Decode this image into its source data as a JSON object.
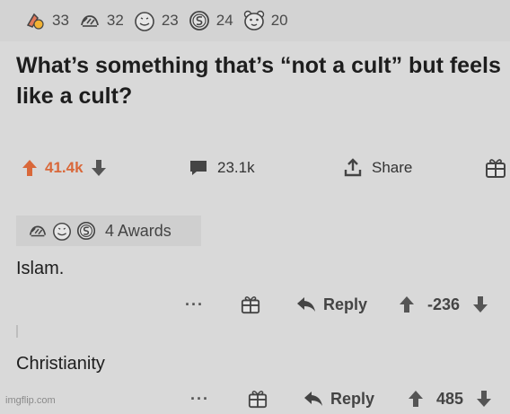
{
  "post": {
    "awards": [
      {
        "icon": "rocket-like-award-icon",
        "count": "33"
      },
      {
        "icon": "hands-award-icon",
        "count": "32"
      },
      {
        "icon": "face-award-icon",
        "count": "23"
      },
      {
        "icon": "coin-award-icon",
        "count": "24"
      },
      {
        "icon": "bear-award-icon",
        "count": "20"
      }
    ],
    "title": "What’s something that’s “not a cult” but feels like a cult?",
    "upvotes": "41.4k",
    "comments": "23.1k",
    "share_label": "Share"
  },
  "comments": [
    {
      "awards_label": "4 Awards",
      "body": "Islam.",
      "reply_label": "Reply",
      "score": "-236",
      "more": "···"
    },
    {
      "body": "Christianity",
      "reply_label": "Reply",
      "score": "485",
      "more": "···"
    }
  ],
  "watermark": "imgflip.com",
  "colors": {
    "background": "#d9d9d9",
    "upvote_accent": "#d9683a",
    "text": "#1d1d1d",
    "muted": "#444444"
  }
}
